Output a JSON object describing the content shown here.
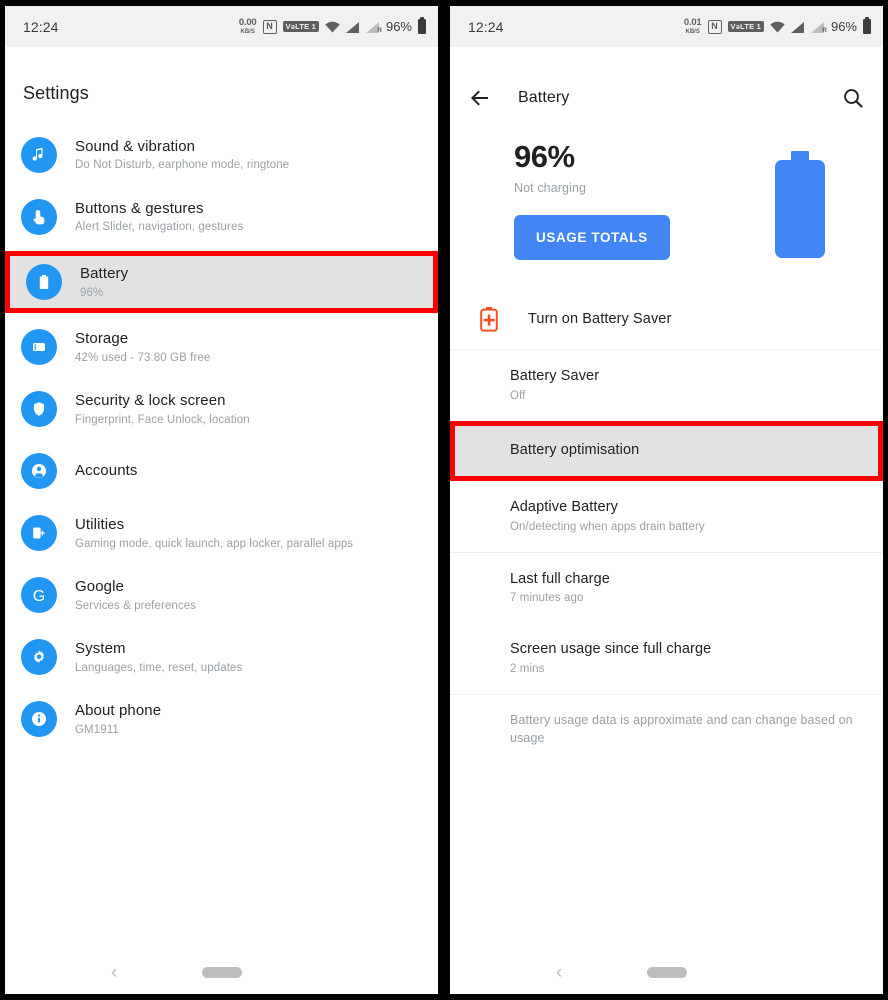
{
  "status_bar": {
    "time": "12:24",
    "net_speed_left": "0.00",
    "net_speed_right": "0.01",
    "net_speed_unit": "KB/S",
    "nfc": "N",
    "volte": "VǝLTE 1",
    "roaming": "R",
    "battery_percent": "96%"
  },
  "settings_screen": {
    "title": "Settings",
    "items": [
      {
        "icon": "music-note-icon",
        "title": "Sound & vibration",
        "subtitle": "Do Not Disturb, earphone mode, ringtone",
        "highlighted": false
      },
      {
        "icon": "tap-gesture-icon",
        "title": "Buttons & gestures",
        "subtitle": "Alert Slider, navigation, gestures",
        "highlighted": false
      },
      {
        "icon": "battery-icon",
        "title": "Battery",
        "subtitle": "96%",
        "highlighted": true
      },
      {
        "icon": "storage-disk-icon",
        "title": "Storage",
        "subtitle": "42% used - 73.80 GB free",
        "highlighted": false
      },
      {
        "icon": "shield-icon",
        "title": "Security & lock screen",
        "subtitle": "Fingerprint, Face Unlock, location",
        "highlighted": false
      },
      {
        "icon": "account-person-icon",
        "title": "Accounts",
        "subtitle": "",
        "highlighted": false
      },
      {
        "icon": "utilities-icon",
        "title": "Utilities",
        "subtitle": "Gaming mode, quick launch, app locker, parallel apps",
        "highlighted": false
      },
      {
        "icon": "google-g-icon",
        "title": "Google",
        "subtitle": "Services & preferences",
        "highlighted": false
      },
      {
        "icon": "gear-icon",
        "title": "System",
        "subtitle": "Languages, time, reset, updates",
        "highlighted": false
      },
      {
        "icon": "info-icon",
        "title": "About phone",
        "subtitle": "GM1911",
        "highlighted": false
      }
    ]
  },
  "battery_screen": {
    "app_bar": {
      "title": "Battery",
      "back_icon": "back-arrow-icon",
      "search_icon": "search-icon"
    },
    "summary": {
      "percent": "96%",
      "state": "Not charging",
      "button_label": "USAGE TOTALS",
      "battery_graphic": "battery-full-icon"
    },
    "battery_saver_action": {
      "icon": "battery-plus-icon",
      "label": "Turn on Battery Saver"
    },
    "preferences": [
      {
        "title": "Battery Saver",
        "subtitle": "Off",
        "highlighted": false
      },
      {
        "title": "Battery optimisation",
        "subtitle": "",
        "highlighted": true
      },
      {
        "title": "Adaptive Battery",
        "subtitle": "On/detecting when apps drain battery",
        "highlighted": false
      },
      {
        "title": "Last full charge",
        "subtitle": "7 minutes ago",
        "highlighted": false
      },
      {
        "title": "Screen usage since full charge",
        "subtitle": "2 mins",
        "highlighted": false
      }
    ],
    "footnote": "Battery usage data is approximate and can change based on usage"
  },
  "nav_bar": {
    "back_glyph": "‹",
    "home_pill": "home-indicator"
  },
  "colors": {
    "accent_blue": "#2196f3",
    "button_blue": "#4285f4",
    "highlight_red": "#ff0000",
    "highlight_fill": "#e2e2e2",
    "battery_saver_red": "#f4511e"
  }
}
